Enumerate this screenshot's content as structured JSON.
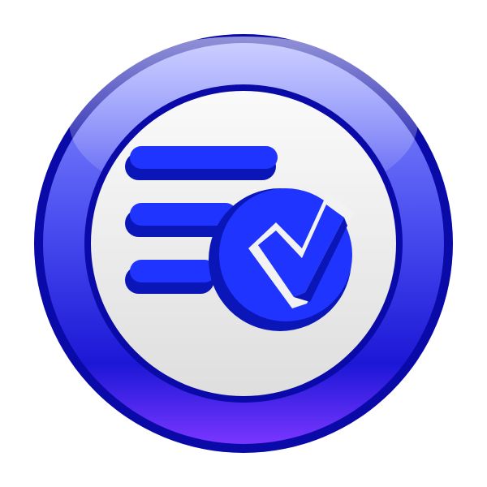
{
  "icon": {
    "name": "task-list-check-icon",
    "style": "glossy-round-badge",
    "colors": {
      "background": "#ffffff",
      "outer_ring": "#0a0aa8",
      "ring_light": "#8f96ff",
      "ring_mid": "#4a4ef0",
      "ring_dark": "#1c17d6",
      "ring_violet": "#7a36ff",
      "inner_face_light": "#fafafa",
      "inner_face_shade": "#dedede",
      "glyph_bright": "#1f35ff",
      "glyph_dark": "#0b16b8"
    },
    "glyph": {
      "list_lines": 3,
      "check_mark": true
    }
  }
}
